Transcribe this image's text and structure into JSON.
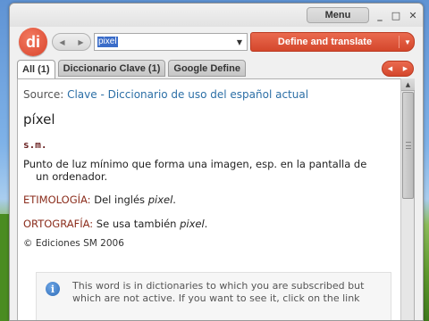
{
  "app": {
    "menu_label": "Menu",
    "logo_text": "di"
  },
  "window_controls": {
    "minimize": "_",
    "maximize": "□",
    "close": "✕"
  },
  "search": {
    "value": "pixel",
    "dropdown_icon": "chevron-down-icon"
  },
  "toolbar": {
    "define_label": "Define and translate",
    "back_icon": "arrow-left-icon",
    "forward_icon": "arrow-right-icon"
  },
  "tabs": [
    {
      "label": "All (1)",
      "active": true
    },
    {
      "label": "Diccionario Clave (1)",
      "active": false
    },
    {
      "label": "Google Define",
      "active": false
    }
  ],
  "entry": {
    "source_prefix": "Source:",
    "source_link": "Clave - Diccionario de uso del español actual",
    "headword": "píxel",
    "pos": "s.m.",
    "definition_line1": "Punto de luz mínimo que forma una imagen, esp. en la pantalla de",
    "definition_line2": "un ordenador.",
    "etym_label": "ETIMOLOGÍA:",
    "etym_text": "Del inglés",
    "etym_word": "pixel",
    "orto_label": "ORTOGRAFÍA:",
    "orto_text": "Se usa también",
    "orto_word": "pixel",
    "copyright": "© Ediciones SM 2006"
  },
  "notice": {
    "icon": "info-icon",
    "text": "This word is in dictionaries to which you are subscribed but which are not active. If you want to see it, click on the link"
  },
  "colors": {
    "accent": "#d9482d",
    "link": "#2c6fa6",
    "label": "#8b2d1c"
  }
}
